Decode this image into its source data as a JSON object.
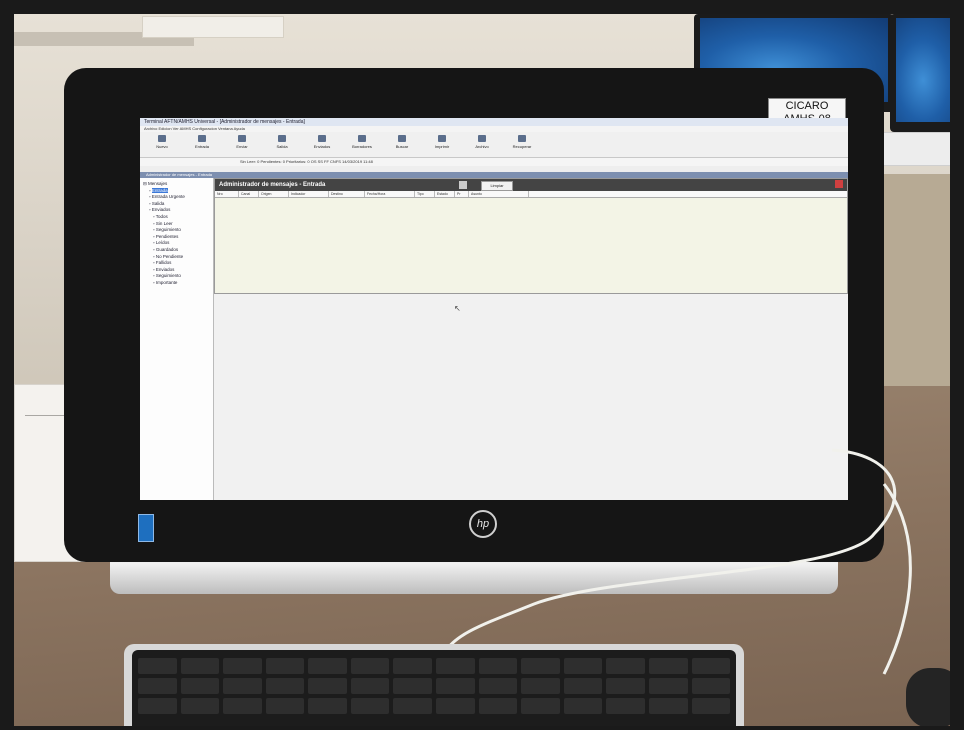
{
  "monitor": {
    "asset_tag_line1": "CICARO",
    "asset_tag_line2": "AMHS-08",
    "brand": "hp"
  },
  "app": {
    "title": "Terminal AFTN/AMHS Universal - [Administrador de mensajes - Entrada]",
    "menu": "Archivo  Edicion  Ver  AMHS  Configuracion  Ventana  Ayuda",
    "toolbar": [
      "Nuevo",
      "Entrada",
      "Enviar",
      "Salida",
      "Enviados",
      "Borradores",
      "Buscar",
      "Imprimir",
      "Archivo",
      "Recuperar"
    ],
    "status": "Sin Leer: 0   Pendientes: 0   Prioritarios: 0   OS  SS  FF  CNFS  14/03/2019  11:48",
    "child_window_title": "Administrador de mensajes - Entrada"
  },
  "tree": [
    "Mensajes",
    "Entrada",
    "Entrada Urgente",
    "Salida",
    "Enviados",
    "Todos",
    "Sin Leer",
    "Seguimiento",
    "Pendientes",
    "Leídos",
    "Guardados",
    "No Pendiente",
    "Fallidos",
    "Enviados",
    "Seguimiento",
    "Importante"
  ],
  "panel": {
    "heading": "Administrador de mensajes - Entrada",
    "filter_button": "Limpiar",
    "columns": [
      "Nro",
      "Canal",
      "Origen",
      "Indicador",
      "Destino",
      "Fecha/Hora",
      "Tipo",
      "Estado",
      "Pr",
      "Asunto"
    ]
  }
}
